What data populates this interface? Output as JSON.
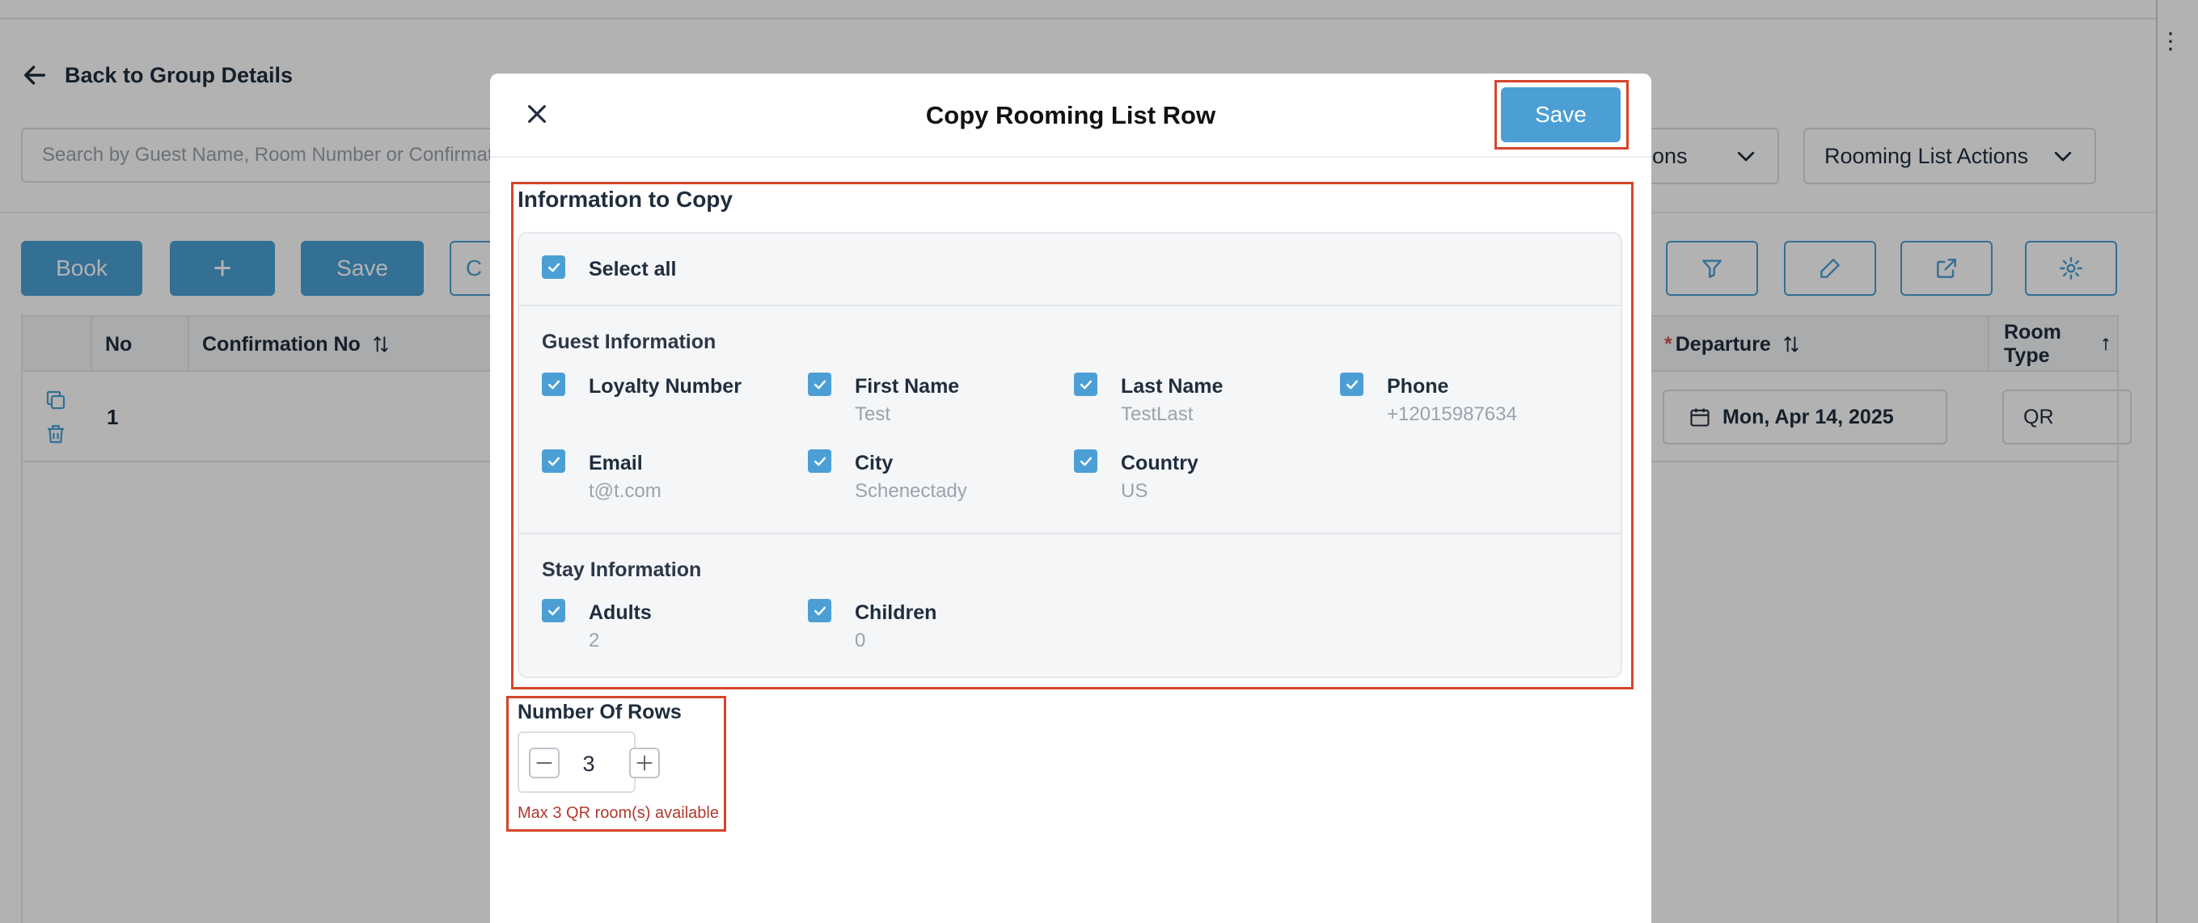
{
  "background": {
    "back_link": "Back to Group Details",
    "search_placeholder": "Search by Guest Name, Room Number or Confirmati",
    "actions_dropdown": "ctions",
    "rooming_list_actions": "Rooming List Actions",
    "buttons": {
      "book": "Book",
      "add": "+",
      "save": "Save",
      "partial": "C"
    },
    "table": {
      "columns": {
        "no": "No",
        "confirmation_no": "Confirmation No",
        "departure_required": "*",
        "departure": "Departure",
        "room_type": "Room Type"
      },
      "row": {
        "no": "1",
        "departure_date": "Mon, Apr 14, 2025",
        "room_type": "QR"
      }
    }
  },
  "modal": {
    "title": "Copy Rooming List Row",
    "save_label": "Save",
    "info_title": "Information to Copy",
    "select_all": "Select all",
    "guest_section": "Guest Information",
    "guest_fields": [
      {
        "label": "Loyalty Number",
        "value": ""
      },
      {
        "label": "First Name",
        "value": "Test"
      },
      {
        "label": "Last Name",
        "value": "TestLast"
      },
      {
        "label": "Phone",
        "value": "+12015987634"
      },
      {
        "label": "Email",
        "value": "t@t.com"
      },
      {
        "label": "City",
        "value": "Schenectady"
      },
      {
        "label": "Country",
        "value": "US"
      }
    ],
    "stay_section": "Stay Information",
    "stay_fields": [
      {
        "label": "Adults",
        "value": "2"
      },
      {
        "label": "Children",
        "value": "0"
      }
    ],
    "rows_label": "Number Of Rows",
    "rows_value": "3",
    "rows_hint": "Max 3 QR room(s) available"
  },
  "colors": {
    "accent": "#4b9fd5",
    "highlight": "#d5452a",
    "hint": "#b03a2e"
  }
}
